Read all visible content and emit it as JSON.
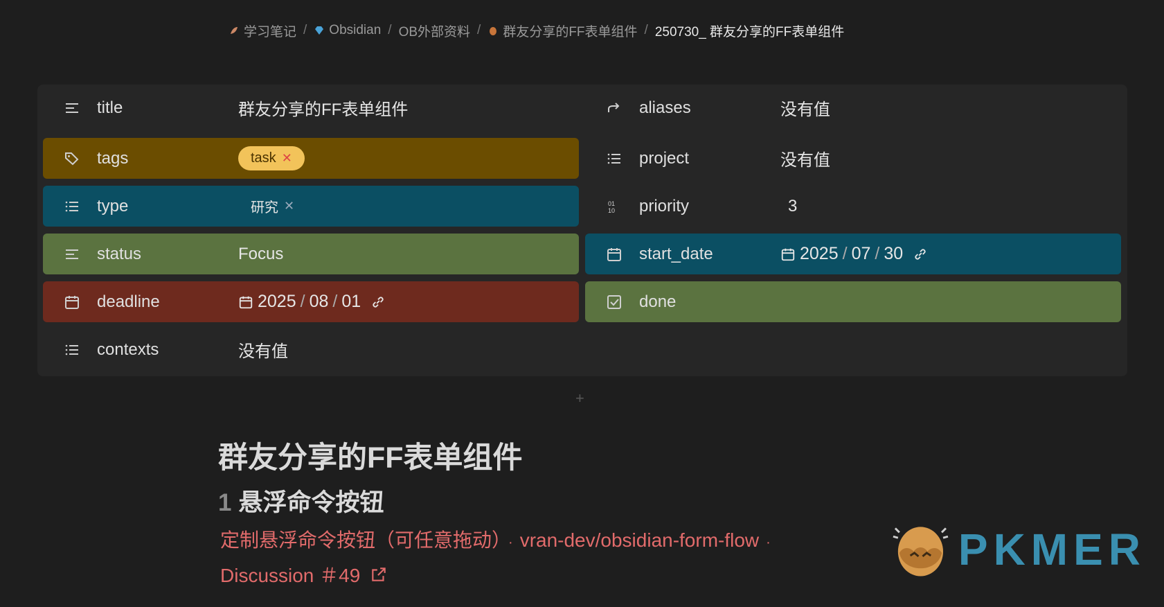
{
  "breadcrumb": {
    "items": [
      "学习笔记",
      "Obsidian",
      "OB外部资料",
      "群友分享的FF表单组件"
    ],
    "current": "250730_ 群友分享的FF表单组件",
    "separator": "/"
  },
  "properties": {
    "title": {
      "name": "title",
      "value": "群友分享的FF表单组件"
    },
    "aliases": {
      "name": "aliases",
      "value": "没有值"
    },
    "tags": {
      "name": "tags",
      "value": "task"
    },
    "project": {
      "name": "project",
      "value": "没有值"
    },
    "type": {
      "name": "type",
      "value": "研究"
    },
    "priority": {
      "name": "priority",
      "value": "3"
    },
    "status": {
      "name": "status",
      "value": "Focus"
    },
    "start_date": {
      "name": "start_date",
      "year": "2025",
      "month": "07",
      "day": "30"
    },
    "deadline": {
      "name": "deadline",
      "year": "2025",
      "month": "08",
      "day": "01"
    },
    "done": {
      "name": "done"
    },
    "contexts": {
      "name": "contexts",
      "value": "没有值"
    }
  },
  "content": {
    "heading1": "群友分享的FF表单组件",
    "heading2_number": "1",
    "heading2_text": "悬浮命令按钮",
    "link1": "定制悬浮命令按钮（可任意拖动）",
    "link2": "vran-dev/obsidian-form-flow",
    "link3": "Discussion ＃49"
  },
  "logo": {
    "text": "PKMER"
  },
  "colors": {
    "background": "#1e1e1e",
    "panel": "#262626",
    "tags_row": "#6b4d00",
    "type_row": "#0b4f63",
    "status_row": "#5b7340",
    "start_date_row": "#0b4f63",
    "deadline_row": "#6e2a1e",
    "done_row": "#5b7340",
    "tag_pill": "#f2c35a",
    "link": "#e26b6b"
  }
}
